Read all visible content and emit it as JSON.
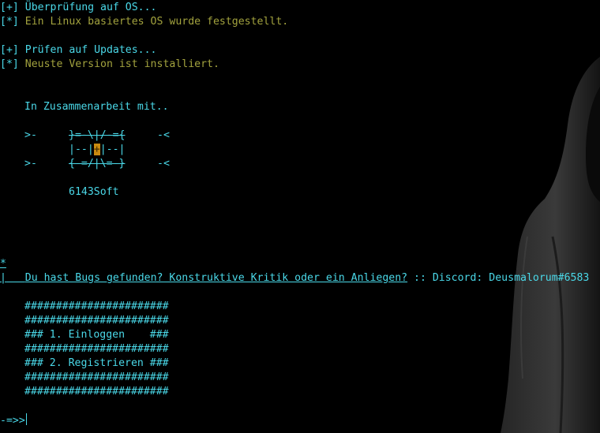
{
  "colors": {
    "background": "#000000",
    "text_primary": "#4ad8e8",
    "text_secondary": "#a2a23e",
    "logo_highlight": "#c88a10"
  },
  "status": [
    {
      "marker": "[+]",
      "text": " Überprüfung auf OS..."
    },
    {
      "marker": "[*]",
      "text": " Ein Linux basiertes OS wurde festgestellt."
    },
    {
      "marker": "[+]",
      "text": " Prüfen auf Updates..."
    },
    {
      "marker": "[*]",
      "text": " Neuste Version ist installiert."
    }
  ],
  "credits": {
    "heading": "In Zusammenarbeit mit..",
    "logo": {
      "row1_left": ">-",
      "row1_art": "}=-\\|/-={",
      "row1_right": "-<",
      "row2_art_a": "|--|",
      "row2_center": "+",
      "row2_art_b": "|--|",
      "row3_left": ">-",
      "row3_art": "{-=/|\\=-}",
      "row3_right": "-<"
    },
    "company": "6143Soft"
  },
  "feedback": {
    "marker_top": "*",
    "marker_bottom": "|",
    "link_text": "Du hast Bugs gefunden? Konstruktive Kritik oder ein Anliegen?",
    "contact": " :: Discord: Deusmalorum#6583"
  },
  "menu": {
    "border": "#######################",
    "option_1": "### 1. Einloggen    ###",
    "option_2": "### 2. Registrieren ###"
  },
  "prompt": {
    "symbol": "-=>>",
    "input_value": ""
  }
}
